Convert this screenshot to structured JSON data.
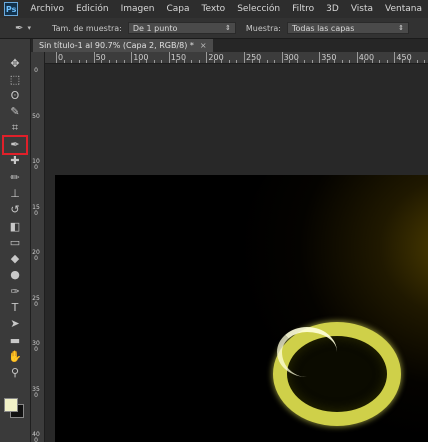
{
  "app": {
    "logo": "Ps"
  },
  "menu": [
    "Archivo",
    "Edición",
    "Imagen",
    "Capa",
    "Texto",
    "Selección",
    "Filtro",
    "3D",
    "Vista",
    "Ventana"
  ],
  "options": {
    "sample_size_label": "Tam. de muestra:",
    "sample_size_value": "De 1 punto",
    "sample_label": "Muestra:",
    "sample_value": "Todas las capas"
  },
  "document": {
    "tab_title": "Sin título-1 al 90.7% (Capa 2, RGB/8) *",
    "close_label": "×"
  },
  "ruler_h": [
    "0",
    "50",
    "100",
    "150",
    "200",
    "250",
    "300",
    "350",
    "400",
    "450"
  ],
  "ruler_v": [
    "0",
    "50",
    "100",
    "150",
    "200",
    "250",
    "300",
    "350",
    "400"
  ],
  "tools": [
    {
      "name": "move-tool-icon",
      "glyph": "✥"
    },
    {
      "name": "marquee-tool-icon",
      "glyph": "⬚"
    },
    {
      "name": "lasso-tool-icon",
      "glyph": "ʘ"
    },
    {
      "name": "quick-selection-tool-icon",
      "glyph": "✎"
    },
    {
      "name": "crop-tool-icon",
      "glyph": "⌗"
    },
    {
      "name": "eyedropper-tool-icon",
      "glyph": "✒",
      "selected": true
    },
    {
      "name": "spot-healing-tool-icon",
      "glyph": "✚"
    },
    {
      "name": "brush-tool-icon",
      "glyph": "✏"
    },
    {
      "name": "clone-stamp-tool-icon",
      "glyph": "⊥"
    },
    {
      "name": "history-brush-tool-icon",
      "glyph": "↺"
    },
    {
      "name": "eraser-tool-icon",
      "glyph": "◧"
    },
    {
      "name": "gradient-tool-icon",
      "glyph": "▭"
    },
    {
      "name": "blur-tool-icon",
      "glyph": "◆"
    },
    {
      "name": "dodge-tool-icon",
      "glyph": "●"
    },
    {
      "name": "pen-tool-icon",
      "glyph": "✑"
    },
    {
      "name": "type-tool-icon",
      "glyph": "T"
    },
    {
      "name": "path-selection-tool-icon",
      "glyph": "➤"
    },
    {
      "name": "rectangle-tool-icon",
      "glyph": "▬"
    },
    {
      "name": "hand-tool-icon",
      "glyph": "✋"
    },
    {
      "name": "zoom-tool-icon",
      "glyph": "⚲"
    }
  ],
  "colors": {
    "foreground": "#f2f2c8",
    "background": "#111111",
    "selection_highlight": "#e0202a"
  }
}
